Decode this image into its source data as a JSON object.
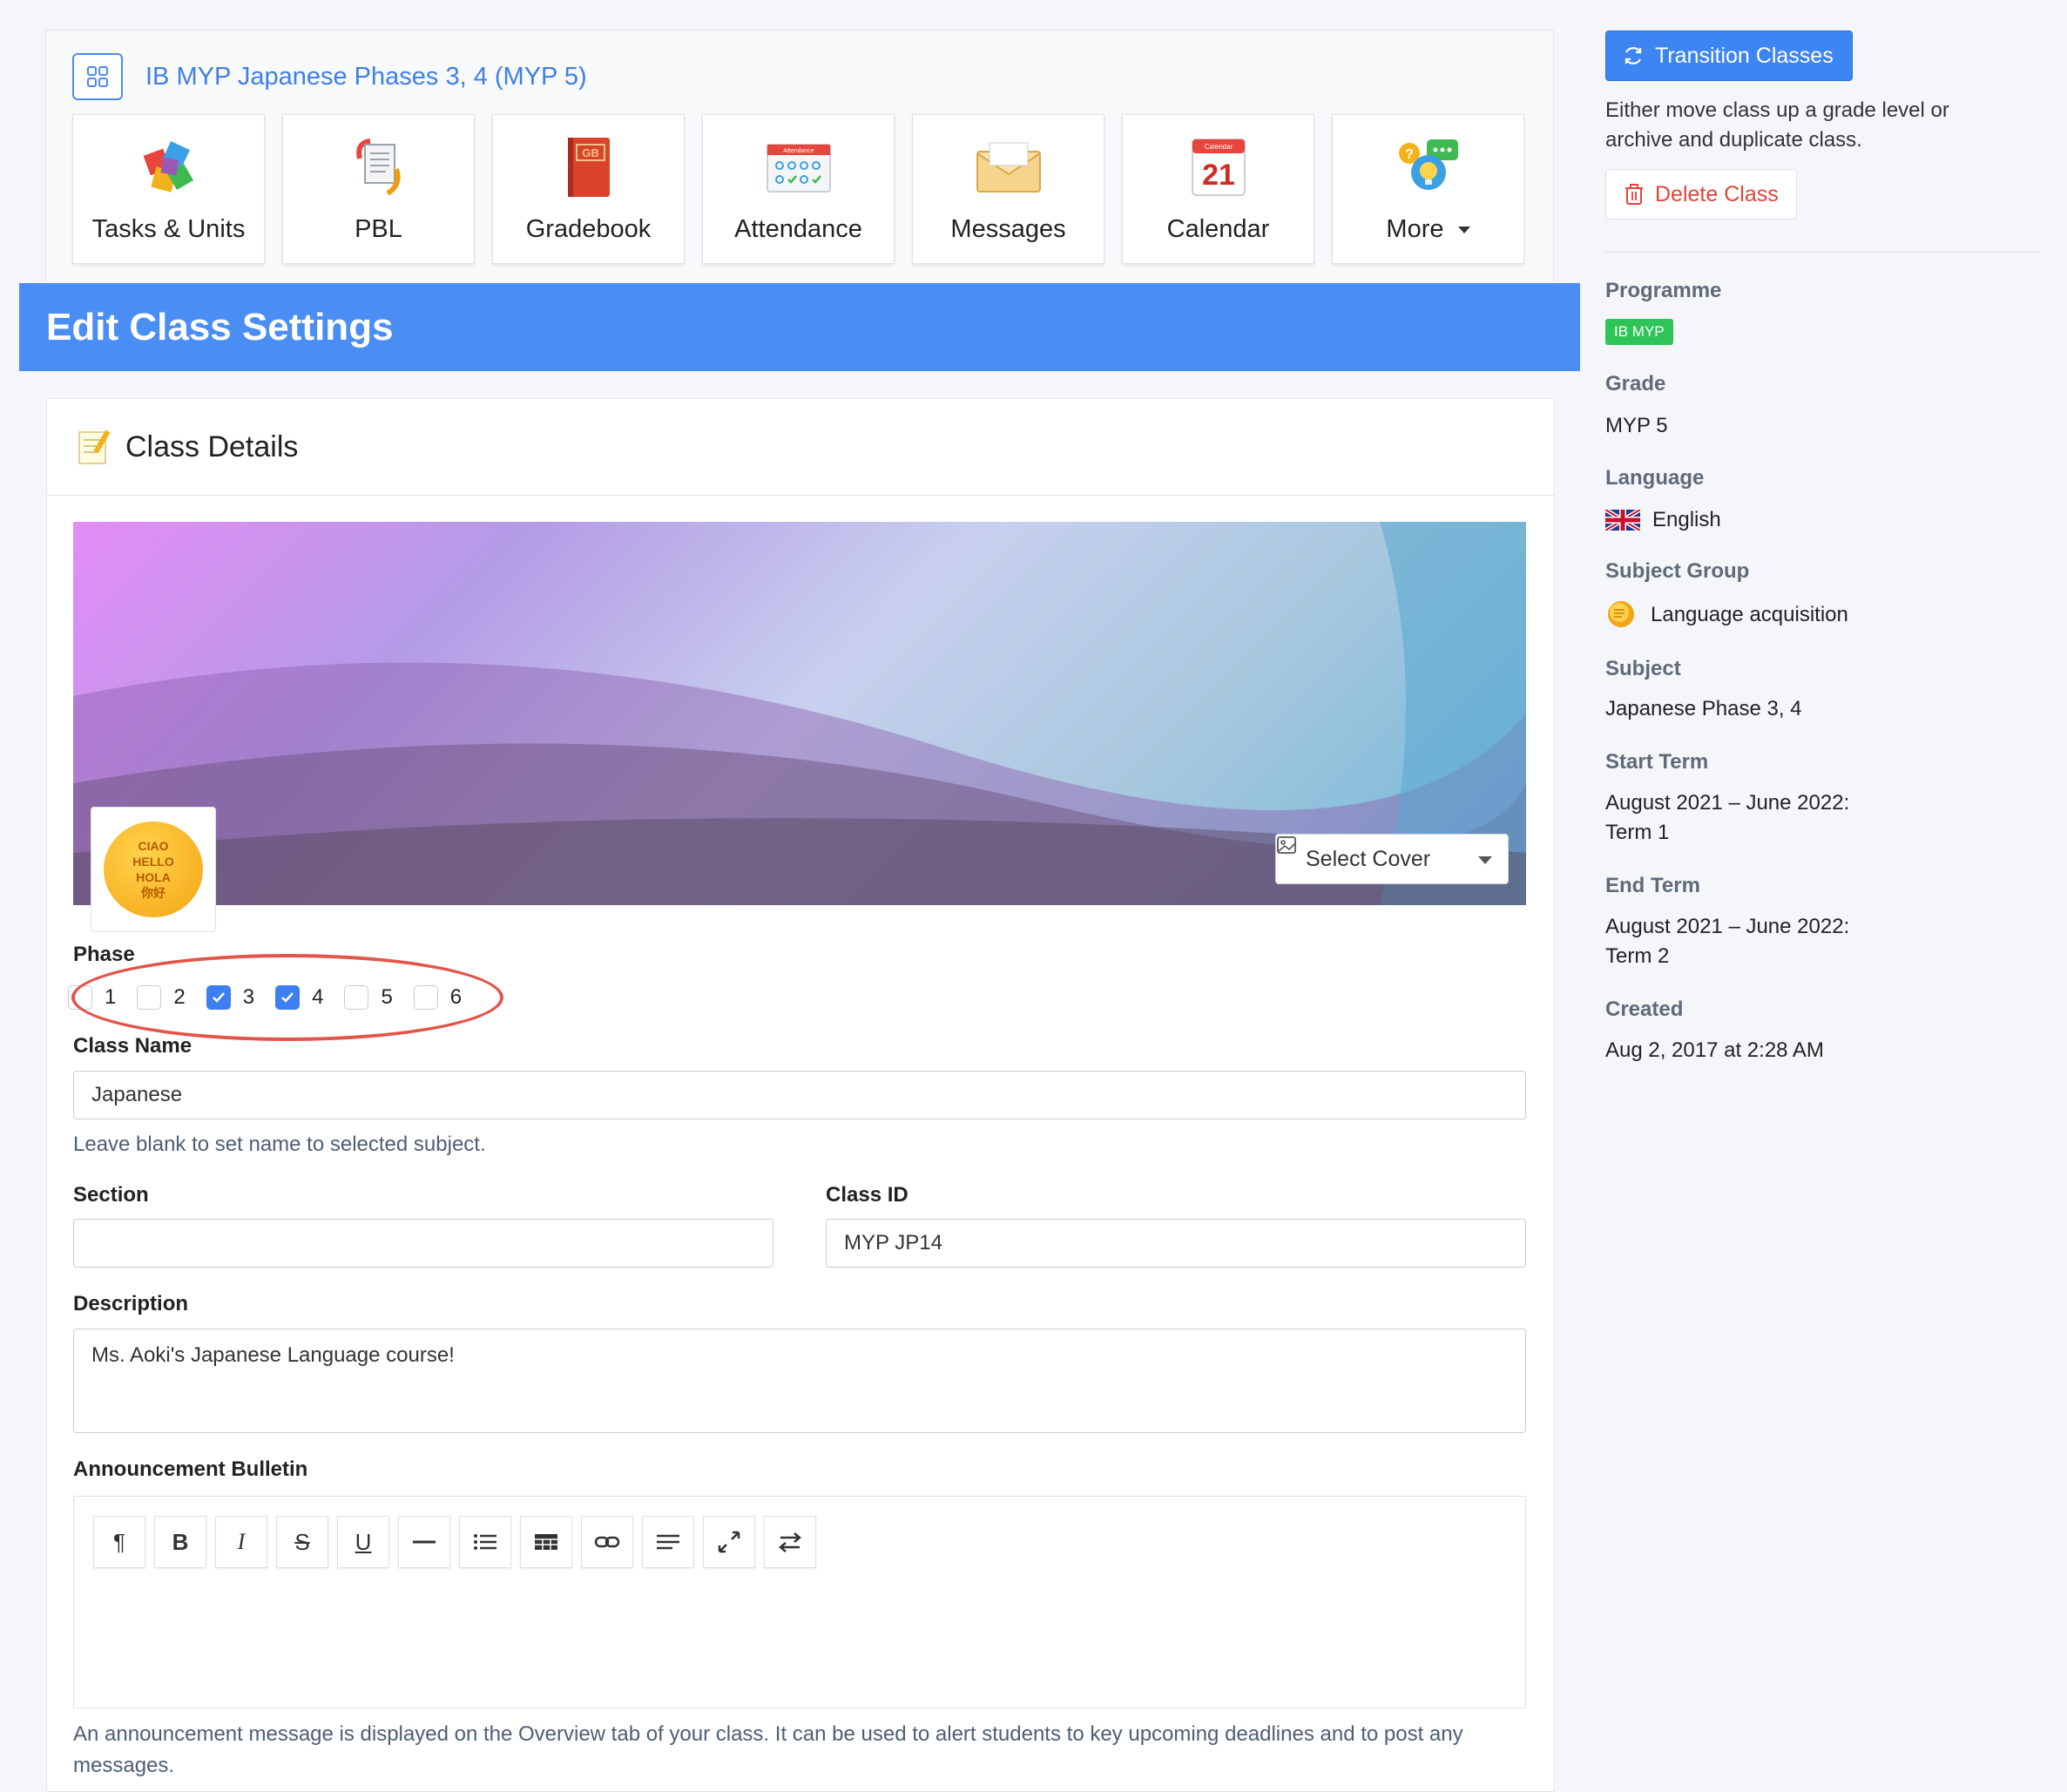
{
  "header": {
    "class_title": "IB MYP Japanese Phases 3, 4 (MYP 5)",
    "tiles": [
      {
        "label": "Tasks & Units",
        "icon": "puzzle-icon"
      },
      {
        "label": "PBL",
        "icon": "pbl-documents-icon"
      },
      {
        "label": "Gradebook",
        "icon": "gradebook-icon"
      },
      {
        "label": "Attendance",
        "icon": "attendance-icon"
      },
      {
        "label": "Messages",
        "icon": "envelope-icon"
      },
      {
        "label": "Calendar",
        "icon": "calendar-icon"
      },
      {
        "label": "More",
        "icon": "more-icon"
      }
    ],
    "gradebook_icon_text": "GB",
    "attendance_icon_text": "Attendance",
    "calendar_icon_header": "Calendar",
    "calendar_icon_day": "21"
  },
  "banner": {
    "title": "Edit Class Settings"
  },
  "class_details": {
    "title": "Class Details",
    "select_cover_label": "Select Cover",
    "avatar_text": [
      "CIAO",
      "HELLO",
      "HOLA",
      "你好"
    ],
    "phase_label": "Phase",
    "phases": [
      {
        "num": "1",
        "checked": false
      },
      {
        "num": "2",
        "checked": false
      },
      {
        "num": "3",
        "checked": true
      },
      {
        "num": "4",
        "checked": true
      },
      {
        "num": "5",
        "checked": false
      },
      {
        "num": "6",
        "checked": false
      }
    ],
    "class_name_label": "Class Name",
    "class_name_value": "Japanese",
    "class_name_help": "Leave blank to set name to selected subject.",
    "section_label": "Section",
    "section_value": "",
    "class_id_label": "Class ID",
    "class_id_value": "MYP JP14",
    "description_label": "Description",
    "description_value": "Ms. Aoki's Japanese Language course!",
    "announcement_label": "Announcement Bulletin",
    "announcement_help": "An announcement message is displayed on the Overview tab of your class. It can be used to alert students to key upcoming deadlines and to post any messages.",
    "toolbar": {
      "paragraph": "¶",
      "bold": "B",
      "italic": "I",
      "strike": "S",
      "underline": "U"
    }
  },
  "sidebar": {
    "transition_label": "Transition Classes",
    "transition_help": "Either move class up a grade level or archive and duplicate class.",
    "delete_label": "Delete Class",
    "programme_label": "Programme",
    "programme_value": "IB MYP",
    "grade_label": "Grade",
    "grade_value": "MYP 5",
    "language_label": "Language",
    "language_value": "English",
    "subject_group_label": "Subject Group",
    "subject_group_value": "Language acquisition",
    "subject_label": "Subject",
    "subject_value": "Japanese Phase 3, 4",
    "start_term_label": "Start Term",
    "start_term_line1": "August 2021 – June 2022:",
    "start_term_line2": "Term 1",
    "end_term_label": "End Term",
    "end_term_line1": "August 2021 – June 2022:",
    "end_term_line2": "Term 2",
    "created_label": "Created",
    "created_value": "Aug 2, 2017 at 2:28 AM"
  },
  "colors": {
    "accent": "#4a8ef4",
    "link": "#3f7fe6",
    "danger": "#e0443a",
    "badge": "#2fc457",
    "highlight": "#e3544a"
  }
}
